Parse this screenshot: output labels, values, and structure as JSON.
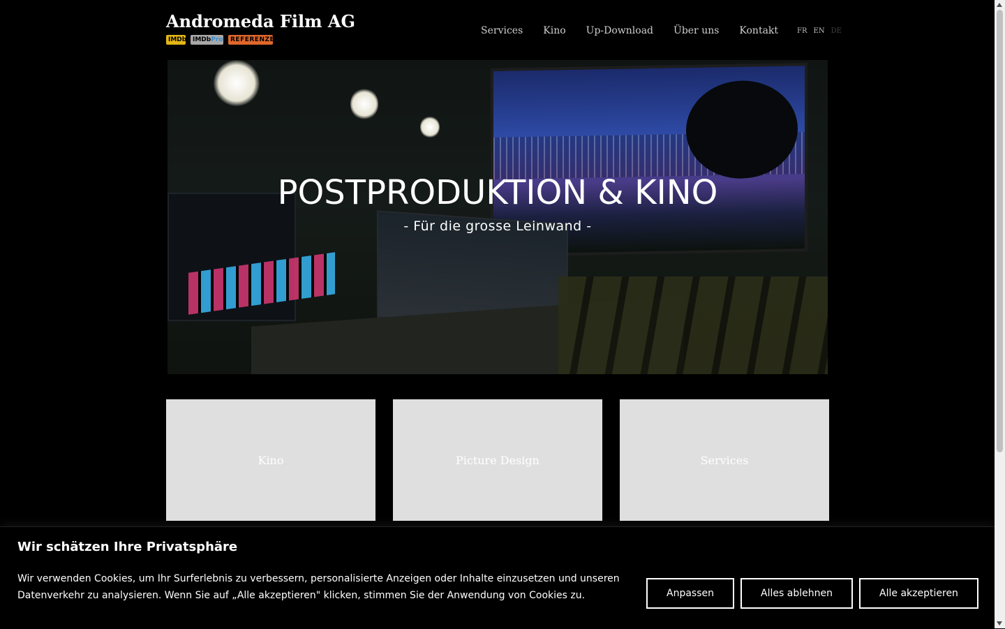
{
  "header": {
    "site_title": "Andromeda Film AG",
    "badges": {
      "imdb": "IMDb",
      "imdbpro_prefix": "IMDb",
      "imdbpro_suffix": "Pro",
      "referenzen": "REFERENZEN"
    },
    "nav": [
      "Services",
      "Kino",
      "Up-Download",
      "Über uns",
      "Kontakt"
    ],
    "languages": [
      "FR",
      "EN",
      "DE"
    ],
    "active_language": "DE"
  },
  "hero": {
    "title": "POSTPRODUKTION & KINO",
    "subtitle": "- Für die grosse Leinwand -"
  },
  "cards": [
    "Kino",
    "Picture Design",
    "Services"
  ],
  "cookie_banner": {
    "title": "Wir schätzen Ihre Privatsphäre",
    "text": "Wir verwenden Cookies, um Ihr Surferlebnis zu verbessern, personalisierte Anzeigen oder Inhalte einzusetzen und unseren Datenverkehr zu analysieren. Wenn Sie auf „Alle akzeptieren\" klicken, stimmen Sie der Anwendung von Cookies zu.",
    "buttons": {
      "customize": "Anpassen",
      "reject_all": "Alles ablehnen",
      "accept_all": "Alle akzeptieren"
    }
  },
  "colors": {
    "background": "#000000",
    "card": "#dfdfdf",
    "imdb_yellow": "#e2b616",
    "referenzen_orange": "#e0672b"
  }
}
